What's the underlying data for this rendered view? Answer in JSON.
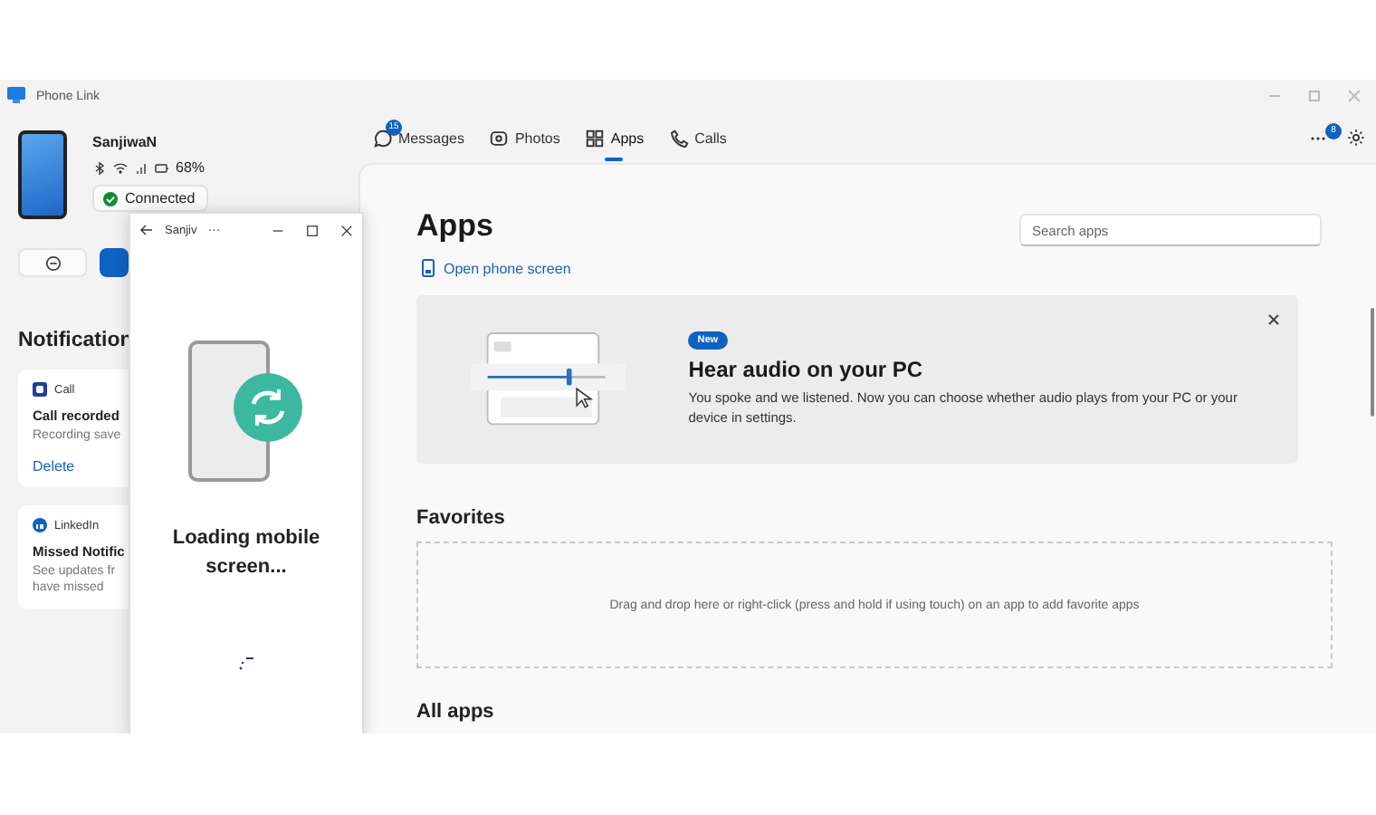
{
  "window": {
    "title": "Phone Link"
  },
  "device": {
    "name": "SanjiwaN",
    "battery": "68%",
    "status": "Connected"
  },
  "sidebar": {
    "heading": "Notification",
    "notifications": [
      {
        "app": "Call",
        "kind": "call",
        "title": "Call recorded",
        "body": [
          "Recording save"
        ],
        "action": "Delete"
      },
      {
        "app": "LinkedIn",
        "kind": "linkedin",
        "title": "Missed Notific",
        "body": [
          "See updates fr",
          "have missed"
        ]
      }
    ]
  },
  "tabs": [
    {
      "label": "Messages",
      "kind": "messages",
      "badge": "15",
      "selected": false
    },
    {
      "label": "Photos",
      "kind": "photos",
      "selected": false
    },
    {
      "label": "Apps",
      "kind": "apps",
      "selected": true
    },
    {
      "label": "Calls",
      "kind": "calls",
      "selected": false
    }
  ],
  "more_badge": "8",
  "page": {
    "title": "Apps",
    "link": "Open phone screen",
    "search_placeholder": "Search apps"
  },
  "banner": {
    "badge": "New",
    "title": "Hear audio on your PC",
    "text": "You spoke and we listened. Now you can choose whether audio plays from your PC or your device in settings."
  },
  "favorites": {
    "heading": "Favorites",
    "hint": "Drag and drop here or right-click (press and hold if using touch) on an app to add favorite apps"
  },
  "all_apps": {
    "heading": "All apps"
  },
  "phone_window": {
    "title": "Sanjiv",
    "more": "···",
    "message": "Loading mobile screen..."
  }
}
